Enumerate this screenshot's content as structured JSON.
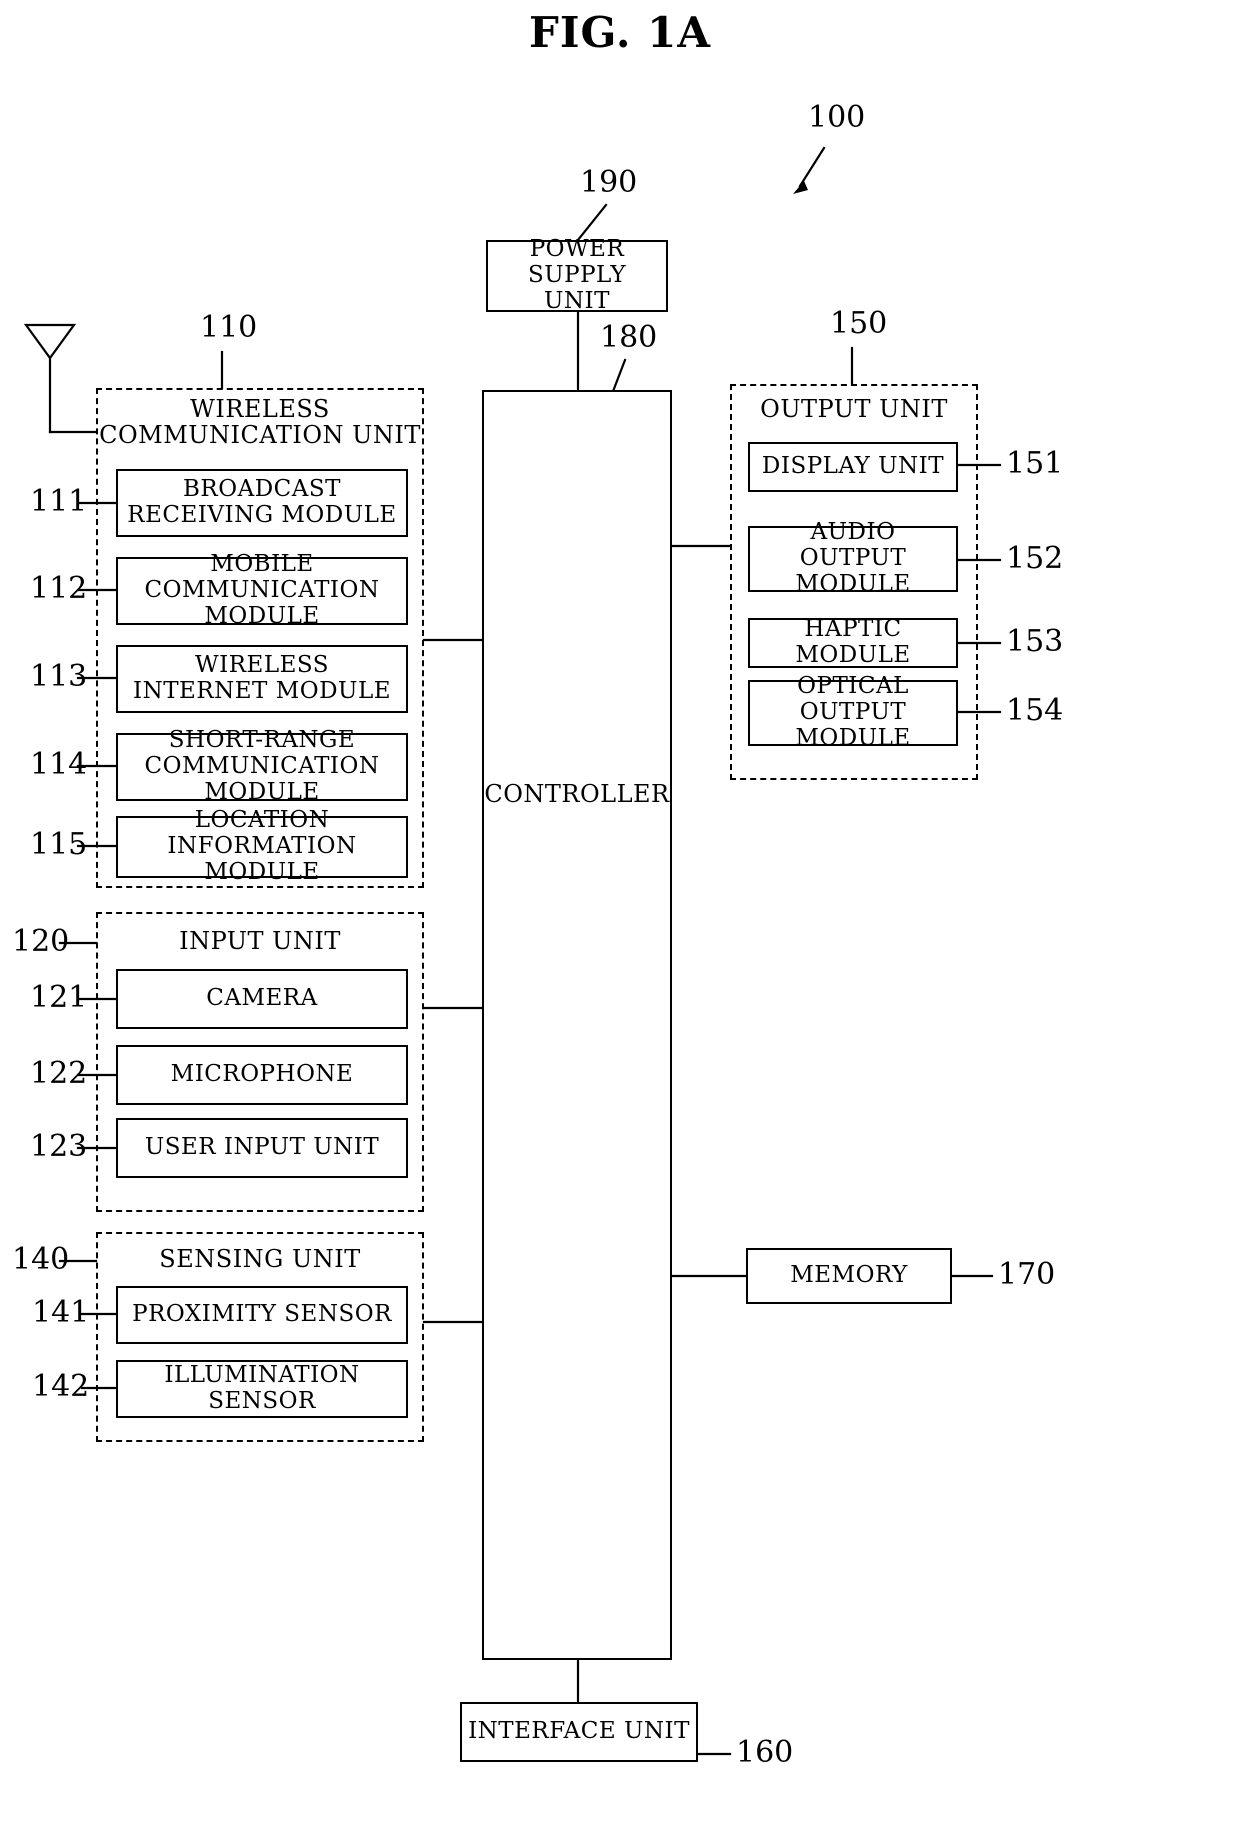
{
  "figure": {
    "title": "FIG. 1A",
    "device_ref": "100"
  },
  "power_supply": {
    "label": "POWER SUPPLY\nUNIT",
    "ref": "190"
  },
  "controller": {
    "label": "CONTROLLER",
    "ref": "180"
  },
  "wireless_communication_unit": {
    "title": "WIRELESS\nCOMMUNICATION UNIT",
    "ref": "110",
    "modules": [
      {
        "label": "BROADCAST\nRECEIVING MODULE",
        "ref": "111"
      },
      {
        "label": "MOBILE\nCOMMUNICATION MODULE",
        "ref": "112"
      },
      {
        "label": "WIRELESS\nINTERNET MODULE",
        "ref": "113"
      },
      {
        "label": "SHORT-RANGE\nCOMMUNICATION MODULE",
        "ref": "114"
      },
      {
        "label": "LOCATION\nINFORMATION MODULE",
        "ref": "115"
      }
    ]
  },
  "input_unit": {
    "title": "INPUT UNIT",
    "ref": "120",
    "modules": [
      {
        "label": "CAMERA",
        "ref": "121"
      },
      {
        "label": "MICROPHONE",
        "ref": "122"
      },
      {
        "label": "USER INPUT UNIT",
        "ref": "123"
      }
    ]
  },
  "sensing_unit": {
    "title": "SENSING UNIT",
    "ref": "140",
    "modules": [
      {
        "label": "PROXIMITY SENSOR",
        "ref": "141"
      },
      {
        "label": "ILLUMINATION SENSOR",
        "ref": "142"
      }
    ]
  },
  "output_unit": {
    "title": "OUTPUT UNIT",
    "ref": "150",
    "modules": [
      {
        "label": "DISPLAY UNIT",
        "ref": "151"
      },
      {
        "label": "AUDIO OUTPUT\nMODULE",
        "ref": "152"
      },
      {
        "label": "HAPTIC MODULE",
        "ref": "153"
      },
      {
        "label": "OPTICAL OUTPUT\nMODULE",
        "ref": "154"
      }
    ]
  },
  "memory": {
    "label": "MEMORY",
    "ref": "170"
  },
  "interface_unit": {
    "label": "INTERFACE UNIT",
    "ref": "160"
  },
  "antenna": {
    "name": "antenna-symbol"
  }
}
